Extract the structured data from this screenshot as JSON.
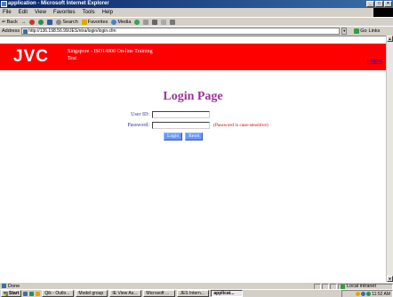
{
  "window": {
    "title": "application - Microsoft Internet Explorer",
    "buttons": [
      "_",
      "□",
      "×"
    ]
  },
  "menu": [
    "File",
    "Edit",
    "View",
    "Favorites",
    "Tools",
    "Help"
  ],
  "toolbar": {
    "back": "Back",
    "forward": "→",
    "search": "Search",
    "favorites": "Favorites",
    "media": "Media"
  },
  "address": {
    "label": "Address",
    "url": "http://136.198.56.99/JES/ntra/login/login.cfm",
    "go": "Go",
    "links": "Links"
  },
  "page": {
    "logo": "JVC",
    "banner_line1": "Singapore - ISO14000 On-line Training",
    "banner_line2": "Test",
    "logout": "Logout",
    "title": "Login Page",
    "userid_label": "User ID:",
    "password_label": "Password:",
    "password_note": "(Password is case-sensitive)",
    "login_button": "Login",
    "reset_button": "Reset",
    "colors": {
      "banner": "#ff0000",
      "title": "#993399",
      "labels": "#333399",
      "note": "#cc0000",
      "buttons": "#6699ff"
    }
  },
  "status": {
    "text": "Done",
    "zone": "Local intranet"
  },
  "taskbar": {
    "start": "Start",
    "tasks": [
      "Qik - Outlo...",
      "Model group",
      "IE View As...",
      "Microsoft ...",
      "JES Intern...",
      "applicat..."
    ],
    "clock": "11:52 AM"
  }
}
